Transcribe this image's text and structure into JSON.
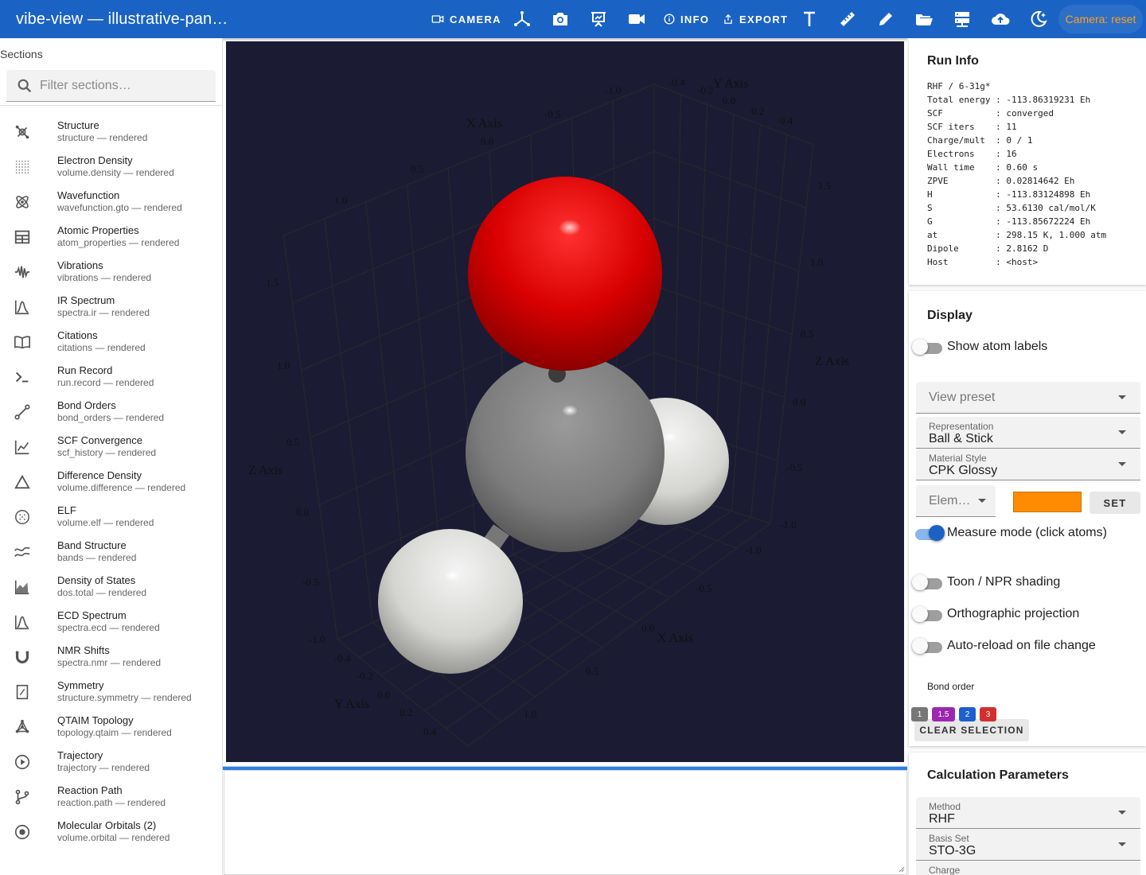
{
  "app": {
    "title": "vibe-view — illustrative-pan…"
  },
  "toolbar": {
    "camera_label": "CAMERA",
    "info_label": "INFO",
    "export_label": "EXPORT",
    "camera_status": "Camera: reset",
    "icons": [
      "axes-icon",
      "screenshot-icon",
      "presentation-icon",
      "video-record-icon",
      "text-icon",
      "ruler-icon",
      "pencil-icon",
      "folder-open-icon",
      "server-icon",
      "cloud-upload-icon",
      "theme-night-icon"
    ]
  },
  "sidebar": {
    "heading": "Sections",
    "search_placeholder": "Filter sections…",
    "items": [
      {
        "title": "Structure",
        "sub": "structure — rendered",
        "icon": "molecule-icon"
      },
      {
        "title": "Electron Density",
        "sub": "volume.density — rendered",
        "icon": "dot-grid-icon"
      },
      {
        "title": "Wavefunction",
        "sub": "wavefunction.gto — rendered",
        "icon": "atom-icon"
      },
      {
        "title": "Atomic Properties",
        "sub": "atom_properties — rendered",
        "icon": "table-icon"
      },
      {
        "title": "Vibrations",
        "sub": "vibrations — rendered",
        "icon": "waveform-icon"
      },
      {
        "title": "IR Spectrum",
        "sub": "spectra.ir — rendered",
        "icon": "peak-icon"
      },
      {
        "title": "Citations",
        "sub": "citations — rendered",
        "icon": "book-open-icon"
      },
      {
        "title": "Run Record",
        "sub": "run.record — rendered",
        "icon": "console-icon"
      },
      {
        "title": "Bond Orders",
        "sub": "bond_orders — rendered",
        "icon": "bond-icon"
      },
      {
        "title": "SCF Convergence",
        "sub": "scf_history — rendered",
        "icon": "line-chart-icon"
      },
      {
        "title": "Difference Density",
        "sub": "volume.difference — rendered",
        "icon": "triangle-icon"
      },
      {
        "title": "ELF",
        "sub": "volume.elf — rendered",
        "icon": "dotted-circle-icon"
      },
      {
        "title": "Band Structure",
        "sub": "bands — rendered",
        "icon": "bands-icon"
      },
      {
        "title": "Density of States",
        "sub": "dos.total — rendered",
        "icon": "area-chart-icon"
      },
      {
        "title": "ECD Spectrum",
        "sub": "spectra.ecd — rendered",
        "icon": "peak-icon"
      },
      {
        "title": "NMR Shifts",
        "sub": "spectra.nmr — rendered",
        "icon": "magnet-icon"
      },
      {
        "title": "Symmetry",
        "sub": "structure.symmetry — rendered",
        "icon": "symmetry-icon"
      },
      {
        "title": "QTAIM Topology",
        "sub": "topology.qtaim — rendered",
        "icon": "graph-icon"
      },
      {
        "title": "Trajectory",
        "sub": "trajectory — rendered",
        "icon": "play-circle-icon"
      },
      {
        "title": "Reaction Path",
        "sub": "reaction.path — rendered",
        "icon": "branch-icon"
      },
      {
        "title": "Molecular Orbitals (2)",
        "sub": "volume.orbital — rendered",
        "icon": "orbital-icon"
      }
    ]
  },
  "viewer": {
    "background": "#1b1b33",
    "axis_titles": {
      "x": "X Axis",
      "y": "Y Axis",
      "z": "Z Axis"
    },
    "tick_labels": {
      "top_x": [
        "-1.0",
        "-0.5",
        "0.0",
        "0.5",
        "1.0"
      ],
      "top_y": [
        "-0.4",
        "-0.2",
        "0.0",
        "0.2",
        "0.4"
      ],
      "left_z": [
        "1.5",
        "1.0",
        "0.5",
        "0.0",
        "-0.5",
        "-1.0"
      ],
      "right_z": [
        "1.5",
        "1.0",
        "0.5",
        "0.0",
        "-0.5",
        "-1.0"
      ],
      "right_x": [
        "-1.0",
        "-0.5",
        "0.0",
        "0.5",
        "1.0"
      ],
      "bottom_y": [
        "-0.4",
        "-0.2",
        "0.0",
        "0.2",
        "0.4"
      ]
    },
    "atoms": [
      {
        "element": "O",
        "color": "#d40000"
      },
      {
        "element": "C",
        "color": "#8a8a8a"
      },
      {
        "element": "H",
        "color": "#e8e8e8"
      },
      {
        "element": "H",
        "color": "#e8e8e8"
      }
    ]
  },
  "run_info": {
    "heading": "Run Info",
    "lines": [
      "RHF / 6-31g*",
      "Total energy : -113.86319231 Eh",
      "SCF          : converged",
      "SCF iters    : 11",
      "Charge/mult  : 0 / 1",
      "Electrons    : 16",
      "Wall time    : 0.60 s",
      "ZPVE         : 0.02814642 Eh",
      "H            : -113.83124898 Eh",
      "S            : 53.6130 cal/mol/K",
      "G            : -113.85672224 Eh",
      "at           : 298.15 K, 1.000 atm",
      "Dipole       : 2.8162 D",
      "Host         : <host>"
    ]
  },
  "display": {
    "heading": "Display",
    "show_atom_labels": {
      "label": "Show atom labels",
      "on": false
    },
    "view_preset_placeholder": "View preset",
    "representation": {
      "caption": "Representation",
      "value": "Ball & Stick"
    },
    "material_style": {
      "caption": "Material Style",
      "value": "CPK Glossy"
    },
    "element_placeholder": "Elem…",
    "element_color": "#ff8c00",
    "set_label": "SET",
    "measure_mode": {
      "label": "Measure mode (click atoms)",
      "on": true
    },
    "toon": {
      "label": "Toon / NPR shading",
      "on": false
    },
    "ortho": {
      "label": "Orthographic projection",
      "on": false
    },
    "autoreload": {
      "label": "Auto-reload on file change",
      "on": false
    },
    "bond_order_label": "Bond order",
    "bond_order_chips": [
      {
        "label": "1",
        "color": "#777777"
      },
      {
        "label": "1.5",
        "color": "#9c27b0"
      },
      {
        "label": "2",
        "color": "#1e5fd0"
      },
      {
        "label": "3",
        "color": "#d32f2f"
      }
    ],
    "clear_selection_label": "CLEAR SELECTION"
  },
  "calc_params": {
    "heading": "Calculation Parameters",
    "method": {
      "caption": "Method",
      "value": "RHF"
    },
    "basis": {
      "caption": "Basis Set",
      "value": "STO-3G"
    },
    "charge": {
      "caption": "Charge"
    }
  }
}
